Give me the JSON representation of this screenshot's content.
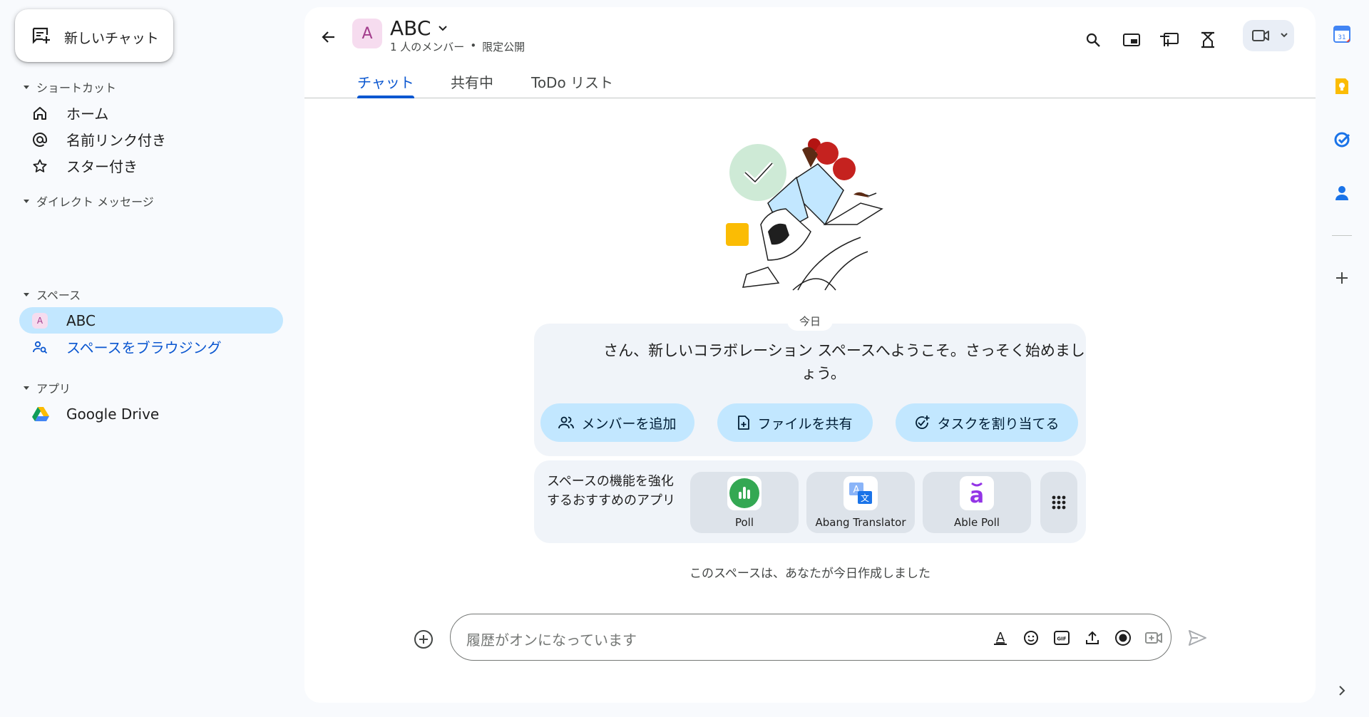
{
  "sidebar": {
    "new_chat_label": "新しいチャット",
    "shortcuts": {
      "title": "ショートカット",
      "items": [
        {
          "label": "ホーム",
          "icon": "home-icon"
        },
        {
          "label": "名前リンク付き",
          "icon": "at-sign-icon"
        },
        {
          "label": "スター付き",
          "icon": "star-icon"
        }
      ]
    },
    "direct_messages": {
      "title": "ダイレクト メッセージ"
    },
    "spaces": {
      "title": "スペース",
      "items": [
        {
          "label": "ABC",
          "avatar": "A",
          "active": true
        },
        {
          "label": "スペースをブラウジング",
          "icon": "browse-spaces-icon"
        }
      ]
    },
    "apps": {
      "title": "アプリ",
      "items": [
        {
          "label": "Google Drive",
          "icon": "google-drive-icon"
        }
      ]
    }
  },
  "header": {
    "avatar": "A",
    "title": "ABC",
    "members": "1 人のメンバー",
    "separator": "•",
    "visibility": "限定公開"
  },
  "tabs": [
    {
      "label": "チャット",
      "active": true
    },
    {
      "label": "共有中",
      "active": false
    },
    {
      "label": "ToDo リスト",
      "active": false
    }
  ],
  "welcome": {
    "date_chip": "今日",
    "message": "さん、新しいコラボレーション スペースへようこそ。さっそく始めましょう。",
    "buttons": {
      "add_members": "メンバーを追加",
      "share_file": "ファイルを共有",
      "assign_task": "タスクを割り当てる"
    }
  },
  "apps_card": {
    "text": "スペースの機能を強化するおすすめのアプリ",
    "apps": [
      {
        "name": "Poll"
      },
      {
        "name": "Abang Translator"
      },
      {
        "name": "Able Poll"
      }
    ]
  },
  "created_note": "このスペースは、あなたが今日作成しました",
  "composer": {
    "placeholder": "履歴がオンになっています",
    "gif_label": "GIF"
  },
  "colors": {
    "accent": "#0b57d0",
    "active_bg": "#c2e7ff",
    "card_bg": "#f0f4f9",
    "avatar_bg": "#f6dcef"
  }
}
